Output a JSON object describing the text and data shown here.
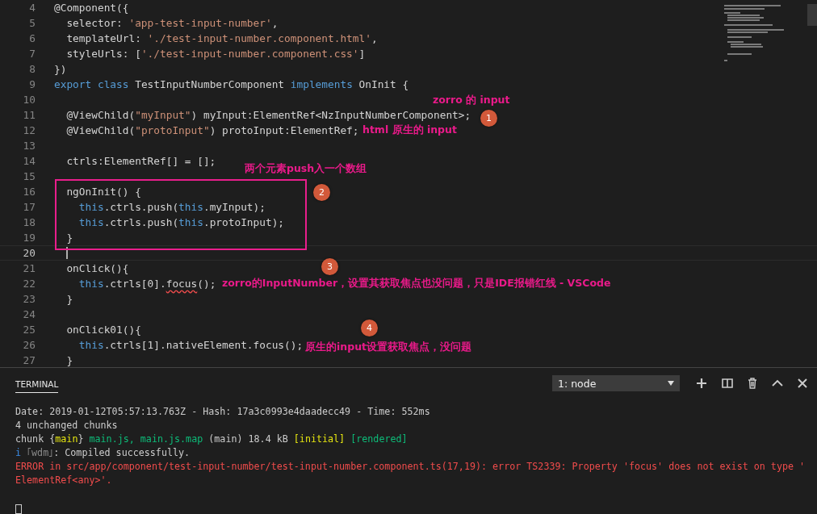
{
  "editor": {
    "lines": [
      {
        "number": "4",
        "current": false,
        "tokens": [
          {
            "kind": "plain",
            "text": "@Component({"
          }
        ]
      },
      {
        "number": "5",
        "current": false,
        "tokens": [
          {
            "kind": "plain",
            "text": "  selector: "
          },
          {
            "kind": "str",
            "text": "'app-test-input-number'"
          },
          {
            "kind": "plain",
            "text": ","
          }
        ]
      },
      {
        "number": "6",
        "current": false,
        "tokens": [
          {
            "kind": "plain",
            "text": "  templateUrl: "
          },
          {
            "kind": "str",
            "text": "'./test-input-number.component.html'"
          },
          {
            "kind": "plain",
            "text": ","
          }
        ]
      },
      {
        "number": "7",
        "current": false,
        "tokens": [
          {
            "kind": "plain",
            "text": "  styleUrls: ["
          },
          {
            "kind": "str",
            "text": "'./test-input-number.component.css'"
          },
          {
            "kind": "plain",
            "text": "]"
          }
        ]
      },
      {
        "number": "8",
        "current": false,
        "tokens": [
          {
            "kind": "plain",
            "text": "})"
          }
        ]
      },
      {
        "number": "9",
        "current": false,
        "tokens": [
          {
            "kind": "kw",
            "text": "export"
          },
          {
            "kind": "kw",
            "text": " class"
          },
          {
            "kind": "plain",
            "text": " TestInputNumberComponent "
          },
          {
            "kind": "kw",
            "text": "implements"
          },
          {
            "kind": "plain",
            "text": " OnInit {"
          }
        ]
      },
      {
        "number": "10",
        "current": false
      },
      {
        "number": "11",
        "current": false,
        "tokens": [
          {
            "kind": "plain",
            "text": "  @ViewChild("
          },
          {
            "kind": "str",
            "text": "\"myInput\""
          },
          {
            "kind": "plain",
            "text": ") myInput:ElementRef<NzInputNumberComponent>;"
          }
        ]
      },
      {
        "number": "12",
        "current": false,
        "tokens": [
          {
            "kind": "plain",
            "text": "  @ViewChild("
          },
          {
            "kind": "str",
            "text": "\"protoInput\""
          },
          {
            "kind": "plain",
            "text": ") protoInput:ElementRef;"
          }
        ]
      },
      {
        "number": "13",
        "current": false
      },
      {
        "number": "14",
        "current": false,
        "tokens": [
          {
            "kind": "plain",
            "text": "  ctrls:ElementRef[] = [];"
          }
        ]
      },
      {
        "number": "15",
        "current": false
      },
      {
        "number": "16",
        "current": false,
        "tokens": [
          {
            "kind": "plain",
            "text": "  ngOnInit() {"
          }
        ]
      },
      {
        "number": "17",
        "current": false,
        "tokens": [
          {
            "kind": "kw",
            "text": "    this"
          },
          {
            "kind": "plain",
            "text": ".ctrls.push("
          },
          {
            "kind": "kw",
            "text": "this"
          },
          {
            "kind": "plain",
            "text": ".myInput);"
          }
        ]
      },
      {
        "number": "18",
        "current": false,
        "tokens": [
          {
            "kind": "kw",
            "text": "    this"
          },
          {
            "kind": "plain",
            "text": ".ctrls.push("
          },
          {
            "kind": "kw",
            "text": "this"
          },
          {
            "kind": "plain",
            "text": ".protoInput);"
          }
        ]
      },
      {
        "number": "19",
        "current": false,
        "tokens": [
          {
            "kind": "plain",
            "text": "  }"
          }
        ]
      },
      {
        "number": "20",
        "current": true
      },
      {
        "number": "21",
        "current": false,
        "tokens": [
          {
            "kind": "plain",
            "text": "  onClick(){"
          }
        ]
      },
      {
        "number": "22",
        "current": false,
        "tokens": [
          {
            "kind": "kw",
            "text": "    this"
          },
          {
            "kind": "plain",
            "text": ".ctrls[0]."
          },
          {
            "kind": "error",
            "text": "focus"
          },
          {
            "kind": "plain",
            "text": "();"
          }
        ]
      },
      {
        "number": "23",
        "current": false,
        "tokens": [
          {
            "kind": "plain",
            "text": "  }"
          }
        ]
      },
      {
        "number": "24",
        "current": false
      },
      {
        "number": "25",
        "current": false,
        "tokens": [
          {
            "kind": "plain",
            "text": "  onClick01(){"
          }
        ]
      },
      {
        "number": "26",
        "current": false,
        "tokens": [
          {
            "kind": "kw",
            "text": "    this"
          },
          {
            "kind": "plain",
            "text": ".ctrls[1].nativeElement.focus();"
          }
        ]
      },
      {
        "number": "27",
        "current": false,
        "tokens": [
          {
            "kind": "plain",
            "text": "  }"
          }
        ]
      }
    ],
    "annotations": [
      "zorro 的 input",
      "html 原生的 input",
      "两个元素push入一个数组",
      "zorro的InputNumber，设置其获取焦点也没问题，只是IDE报错红线 - VSCode",
      "原生的input设置获取焦点，没问题"
    ],
    "badges": [
      "1",
      "2",
      "3",
      "4"
    ]
  },
  "terminal": {
    "tab": "TERMINAL",
    "selector": "1: node",
    "lines": [
      [
        {
          "kind": "plain",
          "text": "Date: 2019-01-12T05:57:13.763Z - Hash: 17a3c0993e4daadecc49 - Time: 552ms"
        }
      ],
      [
        {
          "kind": "plain",
          "text": "4 unchanged chunks"
        }
      ],
      [
        {
          "kind": "plain",
          "text": "chunk {"
        },
        {
          "kind": "yellow",
          "text": "main"
        },
        {
          "kind": "plain",
          "text": "} "
        },
        {
          "kind": "green",
          "text": "main.js, main.js.map"
        },
        {
          "kind": "plain",
          "text": " (main) 18.4 kB "
        },
        {
          "kind": "yellow",
          "text": "[initial]"
        },
        {
          "kind": "green",
          "text": " [rendered]"
        }
      ],
      [
        {
          "kind": "blue",
          "text": "i"
        },
        {
          "kind": "grey",
          "text": " ｢wdm｣"
        },
        {
          "kind": "plain",
          "text": ": Compiled successfully."
        }
      ],
      [
        {
          "kind": "red",
          "text": "ERROR in src/app/component/test-input-number/test-input-number.component.ts(17,19): error TS2339: Property 'focus' does not exist on type '"
        }
      ],
      [
        {
          "kind": "red",
          "text": "ElementRef<any>'."
        }
      ]
    ]
  }
}
